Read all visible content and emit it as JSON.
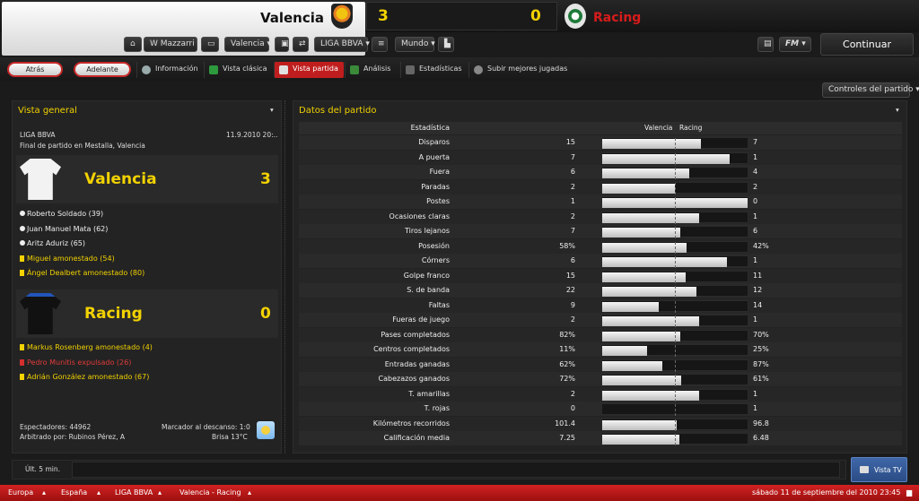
{
  "header": {
    "home_team": "Valencia",
    "home_score": "3",
    "away_score": "0",
    "away_team": "Racing",
    "continue_label": "Continuar"
  },
  "toolbar": {
    "manager": "W Mazzarri",
    "club": "Valencia",
    "league": "LIGA BBVA",
    "world": "Mundo",
    "fm_label": "FM"
  },
  "nav": {
    "back": "Atrás",
    "forward": "Adelante",
    "tabs": [
      "Información",
      "Vista clásica",
      "Vista partida",
      "Análisis",
      "Estadísticas",
      "Subir mejores jugadas"
    ],
    "controls": "Controles del partido"
  },
  "overview": {
    "title": "Vista general",
    "competition": "LIGA BBVA",
    "date": "11.9.2010 20:..",
    "subtitle": "Final de partido en Mestalla, Valencia",
    "home": {
      "name": "Valencia",
      "score": "3",
      "events": [
        {
          "text": "Roberto Soldado (39)",
          "type": "goal"
        },
        {
          "text": "Juan Manuel Mata (62)",
          "type": "goal"
        },
        {
          "text": "Aritz Aduriz (65)",
          "type": "goal"
        },
        {
          "text": "Miguel amonestado (54)",
          "type": "yellow"
        },
        {
          "text": "Ángel Dealbert amonestado (80)",
          "type": "yellow"
        }
      ]
    },
    "away": {
      "name": "Racing",
      "score": "0",
      "events": [
        {
          "text": "Markus Rosenberg amonestado (4)",
          "type": "yellow"
        },
        {
          "text": "Pedro Munitis expulsado (26)",
          "type": "red"
        },
        {
          "text": "Adrián González amonestado (67)",
          "type": "yellow"
        }
      ]
    },
    "attendance": "Espectadores: 44962",
    "referee": "Arbitrado por: Rubinos Pérez, A",
    "halftime": "Marcador al descanso: 1:0",
    "weather": "Brisa 13°C"
  },
  "stats": {
    "title": "Datos del partido",
    "col_stat": "Estadística",
    "col_home": "Valencia",
    "col_away": "Racing",
    "rows": [
      {
        "label": "Disparos",
        "home": "15",
        "away": "7",
        "h": 15,
        "a": 7
      },
      {
        "label": "A puerta",
        "home": "7",
        "away": "1",
        "h": 7,
        "a": 1
      },
      {
        "label": "Fuera",
        "home": "6",
        "away": "4",
        "h": 6,
        "a": 4
      },
      {
        "label": "Paradas",
        "home": "2",
        "away": "2",
        "h": 2,
        "a": 2
      },
      {
        "label": "Postes",
        "home": "1",
        "away": "0",
        "h": 1,
        "a": 0
      },
      {
        "label": "Ocasiones claras",
        "home": "2",
        "away": "1",
        "h": 2,
        "a": 1
      },
      {
        "label": "Tiros lejanos",
        "home": "7",
        "away": "6",
        "h": 7,
        "a": 6
      },
      {
        "label": "Posesión",
        "home": "58%",
        "away": "42%",
        "h": 58,
        "a": 42
      },
      {
        "label": "Córners",
        "home": "6",
        "away": "1",
        "h": 6,
        "a": 1
      },
      {
        "label": "Golpe franco",
        "home": "15",
        "away": "11",
        "h": 15,
        "a": 11
      },
      {
        "label": "S. de banda",
        "home": "22",
        "away": "12",
        "h": 22,
        "a": 12
      },
      {
        "label": "Faltas",
        "home": "9",
        "away": "14",
        "h": 9,
        "a": 14
      },
      {
        "label": "Fueras de juego",
        "home": "2",
        "away": "1",
        "h": 2,
        "a": 1
      },
      {
        "label": "Pases completados",
        "home": "82%",
        "away": "70%",
        "h": 82,
        "a": 70
      },
      {
        "label": "Centros completados",
        "home": "11%",
        "away": "25%",
        "h": 11,
        "a": 25
      },
      {
        "label": "Entradas ganadas",
        "home": "62%",
        "away": "87%",
        "h": 62,
        "a": 87
      },
      {
        "label": "Cabezazos ganados",
        "home": "72%",
        "away": "61%",
        "h": 72,
        "a": 61
      },
      {
        "label": "T. amarillas",
        "home": "2",
        "away": "1",
        "h": 2,
        "a": 1
      },
      {
        "label": "T. rojas",
        "home": "0",
        "away": "1",
        "h": 0,
        "a": 1
      },
      {
        "label": "Kilómetros recorridos",
        "home": "101.4",
        "away": "96.8",
        "h": 101.4,
        "a": 96.8
      },
      {
        "label": "Calificación media",
        "home": "7.25",
        "away": "6.48",
        "h": 7.25,
        "a": 6.48
      }
    ]
  },
  "bottom": {
    "last": "Últ. 5 min.",
    "tv": "Vista TV"
  },
  "footer": {
    "crumbs": [
      "Europa",
      "España",
      "LIGA BBVA",
      "Valencia - Racing"
    ],
    "datetime": "sábado 11 de septiembre del 2010 23:45"
  },
  "colors": {
    "accent_red": "#c01e1e",
    "score_yellow": "#f2d200",
    "away_red": "#d81b1b"
  }
}
